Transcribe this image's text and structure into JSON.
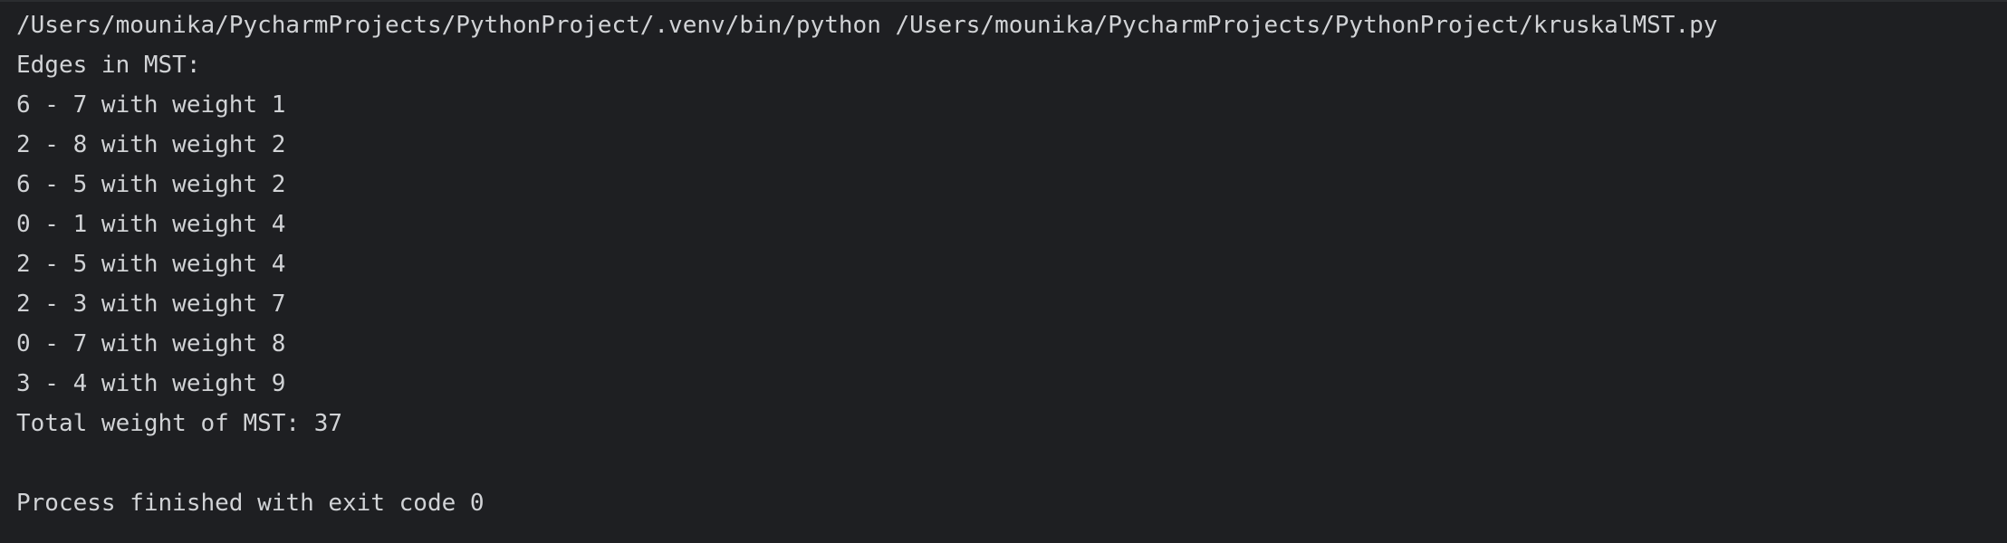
{
  "console": {
    "command": "/Users/mounika/PycharmProjects/PythonProject/.venv/bin/python /Users/mounika/PycharmProjects/PythonProject/kruskalMST.py",
    "header": "Edges in MST:",
    "edges": [
      "6 - 7 with weight 1",
      "2 - 8 with weight 2",
      "6 - 5 with weight 2",
      "0 - 1 with weight 4",
      "2 - 5 with weight 4",
      "2 - 3 with weight 7",
      "0 - 7 with weight 8",
      "3 - 4 with weight 9"
    ],
    "total": "Total weight of MST: 37",
    "exit_message": "Process finished with exit code 0"
  },
  "colors": {
    "background": "#1e1f22",
    "text": "#d1d3d6"
  }
}
